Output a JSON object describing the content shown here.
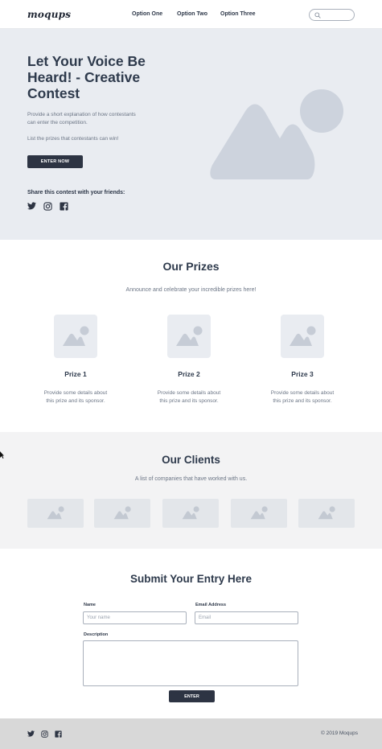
{
  "header": {
    "logo": "moqups",
    "nav": [
      "Option One",
      "Option Two",
      "Option Three"
    ],
    "search_placeholder": ""
  },
  "hero": {
    "title": "Let Your Voice Be Heard! - Creative Contest",
    "description": "Provide a short explanation of how contestants can enter the competition.",
    "prizes_text": "List the prizes that contestants can win!",
    "cta": "ENTER NOW",
    "share_label": "Share this contest with your friends:",
    "social_icons": [
      "twitter-icon",
      "instagram-icon",
      "facebook-icon"
    ]
  },
  "prizes": {
    "title": "Our Prizes",
    "subtitle": "Announce and celebrate your incredible prizes here!",
    "items": [
      {
        "name": "Prize 1",
        "desc": "Provide some details about this prize and its sponsor."
      },
      {
        "name": "Prize 2",
        "desc": "Provide some details about this prize and its sponsor."
      },
      {
        "name": "Prize 3",
        "desc": "Provide some details about this prize and its sponsor."
      }
    ]
  },
  "clients": {
    "title": "Our Clients",
    "subtitle": "A list of companies that have worked with us.",
    "logo_count": 5
  },
  "form": {
    "title": "Submit Your Entry Here",
    "name_label": "Name",
    "name_placeholder": "Your name",
    "email_label": "Email Address",
    "email_placeholder": "Email",
    "description_label": "Description",
    "submit": "ENTER"
  },
  "footer": {
    "copyright": "© 2019  Moqups"
  },
  "colors": {
    "hero_bg": "#e9ecf1",
    "placeholder_art": "#cdd3dd",
    "button": "#2d3443",
    "clients_bg": "#f3f3f4",
    "footer_bg": "#d8d8d8"
  }
}
